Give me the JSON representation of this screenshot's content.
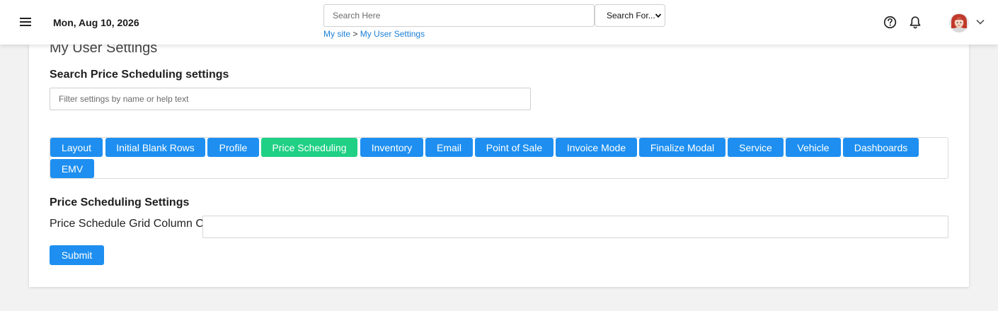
{
  "header": {
    "date": "Mon, Aug 10, 2026",
    "search": {
      "placeholder": "Search Here",
      "value": ""
    },
    "search_for": {
      "selected": "Search For..."
    },
    "breadcrumb": {
      "home": "My site",
      "separator": ">",
      "current": "My User Settings"
    },
    "icons": {
      "menu": "hamburger-menu-icon",
      "help": "question-circle-icon",
      "notifications": "bell-icon",
      "account": "avatar",
      "account_menu": "chevron-down-icon"
    }
  },
  "main": {
    "title": "My User Settings",
    "search_heading": "Search Price Scheduling settings",
    "filter": {
      "placeholder": "Filter settings by name or help text",
      "value": ""
    },
    "tabs": [
      {
        "label": "Layout",
        "active": false
      },
      {
        "label": "Initial Blank Rows",
        "active": false
      },
      {
        "label": "Profile",
        "active": false
      },
      {
        "label": "Price Scheduling",
        "active": true
      },
      {
        "label": "Inventory",
        "active": false
      },
      {
        "label": "Email",
        "active": false
      },
      {
        "label": "Point of Sale",
        "active": false
      },
      {
        "label": "Invoice Mode",
        "active": false
      },
      {
        "label": "Finalize Modal",
        "active": false
      },
      {
        "label": "Service",
        "active": false
      },
      {
        "label": "Vehicle",
        "active": false
      },
      {
        "label": "Dashboards",
        "active": false
      },
      {
        "label": "EMV",
        "active": false
      }
    ],
    "settings_heading": "Price Scheduling Settings",
    "settings": [
      {
        "label": "Price Schedule Grid Column C",
        "value": ""
      }
    ],
    "submit_label": "Submit"
  },
  "colors": {
    "primary": "#1e8ff0",
    "active_tab": "#1fd085",
    "link": "#1a7fd6",
    "page_background": "#f2f2f2"
  }
}
